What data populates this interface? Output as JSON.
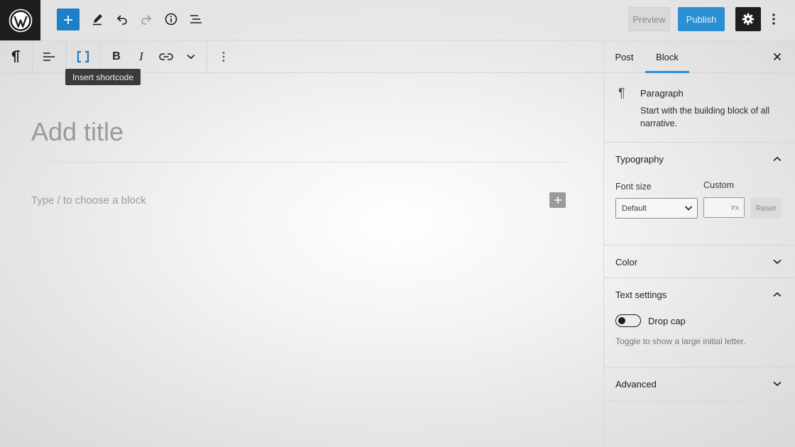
{
  "header": {
    "preview_label": "Preview",
    "publish_label": "Publish",
    "icons": [
      "wordpress-logo-icon",
      "plus-icon",
      "pencil-icon",
      "undo-icon",
      "redo-icon",
      "info-icon",
      "list-view-icon",
      "gear-icon",
      "more-vertical-icon"
    ]
  },
  "block_toolbar": {
    "icons": [
      "paragraph-icon",
      "align-icon",
      "shortcode-icon",
      "bold-icon",
      "italic-icon",
      "link-icon",
      "chevron-down-icon",
      "more-vertical-icon"
    ],
    "bold_glyph": "B",
    "italic_glyph": "I",
    "tooltip": "Insert shortcode"
  },
  "editor": {
    "title_placeholder": "Add title",
    "block_placeholder": "Type / to choose a block"
  },
  "sidebar": {
    "tabs": [
      {
        "label": "Post",
        "active": false
      },
      {
        "label": "Block",
        "active": true
      }
    ],
    "block_card": {
      "icon_glyph": "¶",
      "title": "Paragraph",
      "description": "Start with the building block of all narrative."
    },
    "typography": {
      "title": "Typography",
      "font_size_label": "Font size",
      "custom_label": "Custom",
      "select_value": "Default",
      "custom_unit": "PX",
      "reset_label": "Reset"
    },
    "color": {
      "title": "Color"
    },
    "text_settings": {
      "title": "Text settings",
      "drop_cap_label": "Drop cap",
      "drop_cap_help": "Toggle to show a large initial letter.",
      "drop_cap_on": false
    },
    "advanced": {
      "title": "Advanced"
    }
  },
  "colors": {
    "accent": "#2b8fd3",
    "add_button": "#1e7ec8",
    "dark": "#1e1e1e"
  }
}
